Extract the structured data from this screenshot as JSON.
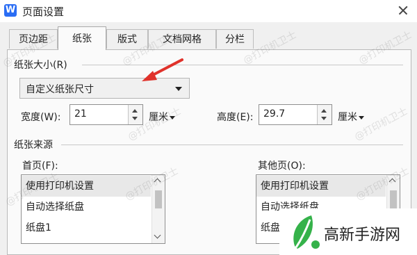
{
  "window": {
    "logo_letter": "W",
    "title": "页面设置"
  },
  "tabs": [
    {
      "label": "页边距",
      "active": false
    },
    {
      "label": "纸张",
      "active": true
    },
    {
      "label": "版式",
      "active": false
    },
    {
      "label": "文档网格",
      "active": false
    },
    {
      "label": "分栏",
      "active": false
    }
  ],
  "paper_size": {
    "section_label": "纸张大小(R)",
    "selected": "自定义纸张尺寸",
    "width_label": "宽度(W):",
    "width_value": "21",
    "width_unit": "厘米",
    "height_label": "高度(E):",
    "height_value": "29.7",
    "height_unit": "厘米"
  },
  "paper_source": {
    "section_label": "纸张来源",
    "first_page_label": "首页(F):",
    "other_pages_label": "其他页(O):",
    "first_page_items": [
      "使用打印机设置",
      "自动选择纸盘",
      "纸盘1"
    ],
    "other_pages_items": [
      "使用打印机设置",
      "自动选择纸盘",
      "纸盘1"
    ]
  },
  "watermark": "@打印机卫士",
  "brand": {
    "name": "高新手游网"
  },
  "colors": {
    "accent_blue": "#2a6df4",
    "annotation_red": "#e0322b",
    "brand_green": "#35b24a"
  }
}
